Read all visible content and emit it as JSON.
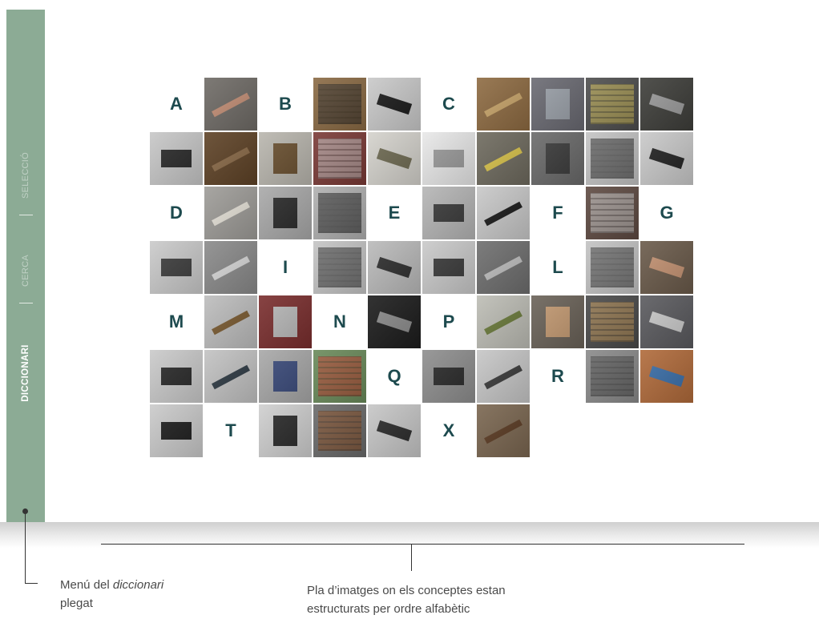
{
  "sidebar": {
    "items": [
      {
        "label": "SELECCIÓ",
        "active": false
      },
      {
        "label": "CERCA",
        "active": false
      },
      {
        "label": "DICCIONARI",
        "active": true
      }
    ],
    "color": "#8cab95"
  },
  "grid": {
    "letter_color": "#1d4a4e",
    "cells": [
      {
        "type": "letter",
        "text": "A"
      },
      {
        "type": "image",
        "icon": "hands-on-type-photo",
        "bg": "#6f6b66",
        "fg": "#c48f76"
      },
      {
        "type": "letter",
        "text": "B"
      },
      {
        "type": "image",
        "icon": "type-case-photo",
        "bg": "#8a6a44",
        "fg": "#2c2a28"
      },
      {
        "type": "image",
        "icon": "brush-photo",
        "bg": "#c9c9c9",
        "fg": "#1a1a1a"
      },
      {
        "type": "letter",
        "text": "C"
      },
      {
        "type": "image",
        "icon": "type-cabinet-drawers-photo",
        "bg": "#8e6b42",
        "fg": "#c9a56a"
      },
      {
        "type": "image",
        "icon": "type-case-compartments-photo",
        "bg": "#6a6a72",
        "fg": "#9aa0a8"
      },
      {
        "type": "image",
        "icon": "composing-sticks-photo",
        "bg": "#4e4e4e",
        "fg": "#d9c45a"
      },
      {
        "type": "image",
        "icon": "casting-machine-photo",
        "bg": "#3e3e3a",
        "fg": "#9a9a9a"
      },
      {
        "type": "image",
        "icon": "key-tool-photo",
        "bg": "#c7c7c7",
        "fg": "#2a2a2a"
      },
      {
        "type": "image",
        "icon": "wooden-cabinet-photo",
        "bg": "#5e4226",
        "fg": "#8a6a48"
      },
      {
        "type": "image",
        "icon": "composing-stick-photo",
        "bg": "#b9b6ae",
        "fg": "#6a5030"
      },
      {
        "type": "image",
        "icon": "form-in-chase-photo",
        "bg": "#7a3a36",
        "fg": "#c9c9c9"
      },
      {
        "type": "image",
        "icon": "string-photo",
        "bg": "#d4d2cc",
        "fg": "#6e6a52"
      },
      {
        "type": "image",
        "icon": "printed-sheet-photo",
        "bg": "#e8e8e8",
        "fg": "#9a9a9a"
      },
      {
        "type": "image",
        "icon": "galley-rack-photo",
        "bg": "#6e6a5e",
        "fg": "#d8c24a"
      },
      {
        "type": "image",
        "icon": "metal-plate-photo",
        "bg": "#6a6a6a",
        "fg": "#3a3a3a"
      },
      {
        "type": "image",
        "icon": "metal-bar-photo",
        "bg": "#c3c3c3",
        "fg": "#2a2a2a"
      },
      {
        "type": "image",
        "icon": "type-gauge-photo",
        "bg": "#c9c9c9",
        "fg": "#222222"
      },
      {
        "type": "letter",
        "text": "D"
      },
      {
        "type": "image",
        "icon": "newspaper-stack-photo",
        "bg": "#9e9c98",
        "fg": "#e6e2d8"
      },
      {
        "type": "image",
        "icon": "ink-bottle-photo",
        "bg": "#a9a9a9",
        "fg": "#2a2a2a"
      },
      {
        "type": "image",
        "icon": "cloth-photo",
        "bg": "#b0b0b0",
        "fg": "#1e1e1e"
      },
      {
        "type": "letter",
        "text": "E"
      },
      {
        "type": "image",
        "icon": "spacer-blocks-photo",
        "bg": "#b5b5b5",
        "fg": "#3a3a3a"
      },
      {
        "type": "image",
        "icon": "knife-photo",
        "bg": "#c8c8c8",
        "fg": "#1a1a1a"
      },
      {
        "type": "letter",
        "text": "F"
      },
      {
        "type": "image",
        "icon": "type-form-photo",
        "bg": "#5e4a42",
        "fg": "#cfcfcf"
      },
      {
        "type": "letter",
        "text": "G"
      },
      {
        "type": "image",
        "icon": "metal-tray-photo",
        "bg": "#cacaca",
        "fg": "#3e3e3e"
      },
      {
        "type": "image",
        "icon": "paper-stacks-photo",
        "bg": "#8a8a8a",
        "fg": "#d8d8d8"
      },
      {
        "type": "letter",
        "text": "I"
      },
      {
        "type": "image",
        "icon": "lead-strips-photo",
        "bg": "#c4c4c4",
        "fg": "#2e2e2e"
      },
      {
        "type": "image",
        "icon": "furniture-blocks-photo",
        "bg": "#bababa",
        "fg": "#2e2e2e"
      },
      {
        "type": "image",
        "icon": "rule-pieces-photo",
        "bg": "#c9c9c9",
        "fg": "#3a3a3a"
      },
      {
        "type": "image",
        "icon": "type-pile-photo",
        "bg": "#6e6e6e",
        "fg": "#bdbdbd"
      },
      {
        "type": "letter",
        "text": "L"
      },
      {
        "type": "image",
        "icon": "angle-pieces-photo",
        "bg": "#c3c3c3",
        "fg": "#3a3a3a"
      },
      {
        "type": "image",
        "icon": "hand-composing-photo",
        "bg": "#6a5a4a",
        "fg": "#c49272"
      },
      {
        "type": "letter",
        "text": "M"
      },
      {
        "type": "image",
        "icon": "mallet-photo",
        "bg": "#bdbdbd",
        "fg": "#7a5a30"
      },
      {
        "type": "image",
        "icon": "chase-form-photo",
        "bg": "#7a2e2e",
        "fg": "#b8b8b8"
      },
      {
        "type": "letter",
        "text": "N"
      },
      {
        "type": "image",
        "icon": "type-sorts-photo",
        "bg": "#1c1c1c",
        "fg": "#8a8a8a"
      },
      {
        "type": "letter",
        "text": "P"
      },
      {
        "type": "image",
        "icon": "type-block-photo",
        "bg": "#bdbdb5",
        "fg": "#6a7a3a"
      },
      {
        "type": "image",
        "icon": "hand-lettering-photo",
        "bg": "#6a6258",
        "fg": "#c49a72"
      },
      {
        "type": "image",
        "icon": "press-rollers-photo",
        "bg": "#4a4a4a",
        "fg": "#c89a5a"
      },
      {
        "type": "image",
        "icon": "type-drawer-photo",
        "bg": "#5a5a5e",
        "fg": "#c9c9c9"
      },
      {
        "type": "image",
        "icon": "tweezers-photo",
        "bg": "#cacaca",
        "fg": "#2a2a2a"
      },
      {
        "type": "image",
        "icon": "proof-press-photo",
        "bg": "#c2c2c2",
        "fg": "#2e3a44"
      },
      {
        "type": "image",
        "icon": "cylinder-press-photo",
        "bg": "#a8a8a8",
        "fg": "#3a4a7a"
      },
      {
        "type": "image",
        "icon": "green-press-photo",
        "bg": "#6a8a5a",
        "fg": "#c0392b"
      },
      {
        "type": "letter",
        "text": "Q"
      },
      {
        "type": "image",
        "icon": "quad-block-photo",
        "bg": "#8e8e8e",
        "fg": "#2a2a2a"
      },
      {
        "type": "image",
        "icon": "small-quad-photo",
        "bg": "#c6c6c6",
        "fg": "#3a3a3a"
      },
      {
        "type": "letter",
        "text": "R"
      },
      {
        "type": "image",
        "icon": "metal-galley-photo",
        "bg": "#8a8a8a",
        "fg": "#4a4a4a"
      },
      {
        "type": "image",
        "icon": "printed-poster-photo",
        "bg": "#b06a3a",
        "fg": "#3a6ea8"
      },
      {
        "type": "image",
        "icon": "ink-roller-photo",
        "bg": "#cacaca",
        "fg": "#1e1e1e"
      },
      {
        "type": "letter",
        "text": "T"
      },
      {
        "type": "image",
        "icon": "ink-tin-photo",
        "bg": "#cfcfcf",
        "fg": "#2a2a2a"
      },
      {
        "type": "image",
        "icon": "wood-type-photo",
        "bg": "#6a6a6a",
        "fg": "#8a4a1e"
      },
      {
        "type": "image",
        "icon": "rule-strip-photo",
        "bg": "#c6c6c6",
        "fg": "#2a2a2a"
      },
      {
        "type": "letter",
        "text": "X"
      },
      {
        "type": "image",
        "icon": "wooden-type-cabinet-photo",
        "bg": "#7a6650",
        "fg": "#5a3a22"
      }
    ]
  },
  "annotations": {
    "menu": {
      "prefix": "Menú del ",
      "italic": "diccionari",
      "suffix": "plegat"
    },
    "plan": "Pla d’imatges on els conceptes estan estructurats per ordre alfabètic"
  }
}
